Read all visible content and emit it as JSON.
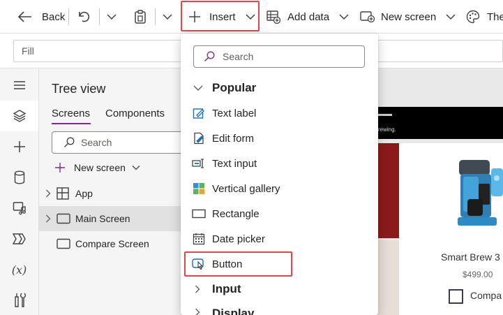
{
  "toolbar": {
    "back_label": "Back",
    "insert_label": "Insert",
    "add_data_label": "Add data",
    "new_screen_label": "New screen",
    "theme_label": "The"
  },
  "formula": {
    "property": "Fill"
  },
  "tree": {
    "title": "Tree view",
    "tabs": [
      {
        "label": "Screens"
      },
      {
        "label": "Components"
      }
    ],
    "search_placeholder": "Search",
    "new_screen_label": "New screen",
    "items": [
      {
        "label": "App"
      },
      {
        "label": "Main Screen"
      },
      {
        "label": "Compare Screen"
      }
    ]
  },
  "insert_menu": {
    "search_placeholder": "Search",
    "popular_label": "Popular",
    "items": [
      {
        "label": "Text label",
        "icon": "text-label-icon"
      },
      {
        "label": "Edit form",
        "icon": "edit-form-icon"
      },
      {
        "label": "Text input",
        "icon": "text-input-icon"
      },
      {
        "label": "Vertical gallery",
        "icon": "vertical-gallery-icon"
      },
      {
        "label": "Rectangle",
        "icon": "rectangle-icon"
      },
      {
        "label": "Date picker",
        "icon": "date-picker-icon"
      },
      {
        "label": "Button",
        "icon": "button-icon"
      }
    ],
    "input_label": "Input",
    "display_label": "Display"
  },
  "preview": {
    "header_fragment": "rewing.",
    "product_name": "Smart Brew 3",
    "price": "$499.00",
    "compare_label": "Compa"
  },
  "colors": {
    "highlight": "#e0474c",
    "accent": "#7a2d8f",
    "icon_blue": "#1d6fb8",
    "gallery_green": "#5db35b",
    "gallery_orange": "#e8a33a",
    "gallery_blue": "#2f8fd8"
  }
}
